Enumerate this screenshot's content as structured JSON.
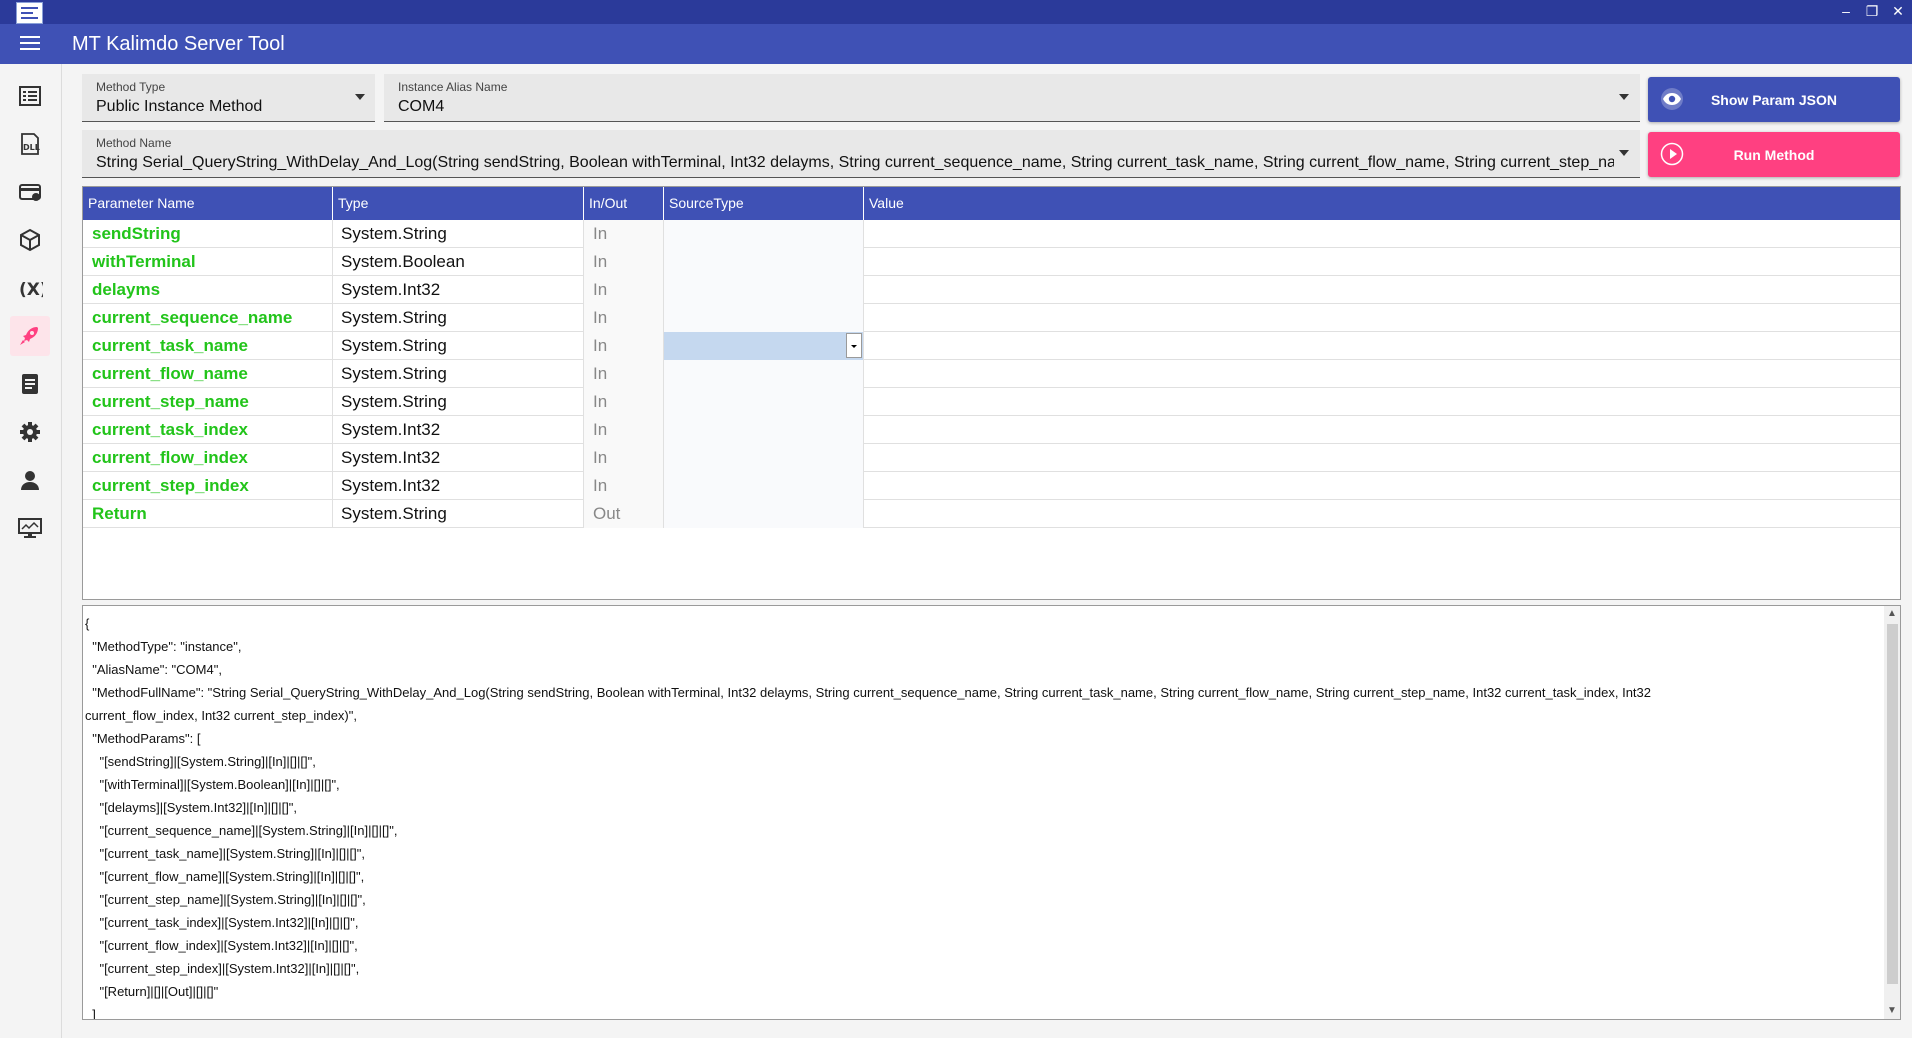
{
  "window": {
    "title": "MT Kalimdo Server Tool",
    "controls": {
      "minimize": "–",
      "restore": "❐",
      "close": "✕"
    }
  },
  "sidebar": {
    "items": [
      {
        "icon": "list-icon"
      },
      {
        "icon": "dll-icon",
        "label": "DLL"
      },
      {
        "icon": "card-icon"
      },
      {
        "icon": "cube-icon"
      },
      {
        "icon": "variable-icon",
        "label": "(X)"
      },
      {
        "icon": "rocket-icon",
        "active": true
      },
      {
        "icon": "document-icon"
      },
      {
        "icon": "gear-icon"
      },
      {
        "icon": "user-icon"
      },
      {
        "icon": "monitor-icon"
      }
    ],
    "accent": "#ff4081"
  },
  "fields": {
    "method_type": {
      "label": "Method Type",
      "value": "Public Instance Method"
    },
    "instance_alias": {
      "label": "Instance Alias Name",
      "value": "COM4"
    },
    "method_name": {
      "label": "Method Name",
      "value": "String Serial_QueryString_WithDelay_And_Log(String sendString, Boolean withTerminal, Int32 delayms, String current_sequence_name, String current_task_name, String current_flow_name, String current_step_name,"
    }
  },
  "buttons": {
    "show_json": "Show Param JSON",
    "run_method": "Run Method"
  },
  "grid": {
    "headers": [
      "Parameter Name",
      "Type",
      "In/Out",
      "SourceType",
      "Value"
    ],
    "rows": [
      {
        "name": "sendString",
        "type": "System.String",
        "io": "In",
        "source": "",
        "value": ""
      },
      {
        "name": "withTerminal",
        "type": "System.Boolean",
        "io": "In",
        "source": "",
        "value": ""
      },
      {
        "name": "delayms",
        "type": "System.Int32",
        "io": "In",
        "source": "",
        "value": ""
      },
      {
        "name": "current_sequence_name",
        "type": "System.String",
        "io": "In",
        "source": "",
        "value": ""
      },
      {
        "name": "current_task_name",
        "type": "System.String",
        "io": "In",
        "source": "",
        "value": ""
      },
      {
        "name": "current_flow_name",
        "type": "System.String",
        "io": "In",
        "source": "",
        "value": ""
      },
      {
        "name": "current_step_name",
        "type": "System.String",
        "io": "In",
        "source": "",
        "value": ""
      },
      {
        "name": "current_task_index",
        "type": "System.Int32",
        "io": "In",
        "source": "",
        "value": ""
      },
      {
        "name": "current_flow_index",
        "type": "System.Int32",
        "io": "In",
        "source": "",
        "value": ""
      },
      {
        "name": "current_step_index",
        "type": "System.Int32",
        "io": "In",
        "source": "",
        "value": ""
      },
      {
        "name": "Return",
        "type": "System.String",
        "io": "Out",
        "source": "",
        "value": ""
      }
    ],
    "selected_row": 4,
    "name_color": "#22c41a",
    "header_color": "#3f51b5"
  },
  "json_lines": [
    "{",
    "  \"MethodType\": \"instance\",",
    "  \"AliasName\": \"COM4\",",
    "  \"MethodFullName\": \"String Serial_QueryString_WithDelay_And_Log(String sendString, Boolean withTerminal, Int32 delayms, String current_sequence_name, String current_task_name, String current_flow_name, String current_step_name, Int32 current_task_index, Int32",
    "current_flow_index, Int32 current_step_index)\",",
    "  \"MethodParams\": [",
    "    \"[sendString]|[System.String]|[In]|[]|[]\",",
    "    \"[withTerminal]|[System.Boolean]|[In]|[]|[]\",",
    "    \"[delayms]|[System.Int32]|[In]|[]|[]\",",
    "    \"[current_sequence_name]|[System.String]|[In]|[]|[]\",",
    "    \"[current_task_name]|[System.String]|[In]|[]|[]\",",
    "    \"[current_flow_name]|[System.String]|[In]|[]|[]\",",
    "    \"[current_step_name]|[System.String]|[In]|[]|[]\",",
    "    \"[current_task_index]|[System.Int32]|[In]|[]|[]\",",
    "    \"[current_flow_index]|[System.Int32]|[In]|[]|[]\",",
    "    \"[current_step_index]|[System.Int32]|[In]|[]|[]\",",
    "    \"[Return]|[]|[Out]|[]|[]\"",
    "  ]"
  ]
}
